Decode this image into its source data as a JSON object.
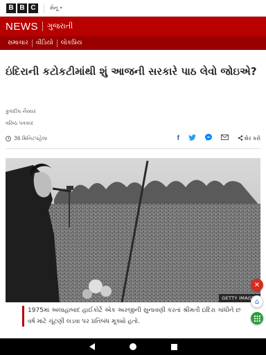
{
  "topbar": {
    "logo_letters": [
      "B",
      "B",
      "C"
    ],
    "menu_label": "મેનૂ"
  },
  "newsbar": {
    "news_label": "NEWS",
    "language_label": "ગુજરાતી"
  },
  "subnav": {
    "items": [
      {
        "label": "સમાચાર"
      },
      {
        "label": "વીડિયો"
      },
      {
        "label": "લોકપ્રિય"
      }
    ]
  },
  "article": {
    "headline": "ઇંદિરાની કટોકટીમાંથી શું આજની સરકારે પાઠ લેવો જોઇએ?",
    "author_name": "કુલદીપ નૈય્યર",
    "author_role": "વરિષ્ઠ પત્રકાર",
    "timestamp": "36 મિનિટપહેલા",
    "share_label": "શેર કરો",
    "image_credit": "GETTY IMAGES",
    "caption": "1975માં અલાહાબાદ હાઈકોર્ટે એક અરજીની સુનાવણી કરતાં શ્રીમતી ઇંદિરા ગાંધીને છ વર્ષ માટે ચૂંટણી લડવા પર પ્રતિબંધ મૂક્યો હતો."
  },
  "icons": {
    "facebook": "facebook-icon",
    "twitter": "twitter-icon",
    "messenger": "messenger-icon",
    "email": "email-icon",
    "share": "share-icon",
    "clock": "clock-icon"
  },
  "colors": {
    "brand_red": "#b80000",
    "subnav_red": "#9a0000",
    "facebook_blue": "#3b5998",
    "twitter_blue": "#1da1f2"
  }
}
